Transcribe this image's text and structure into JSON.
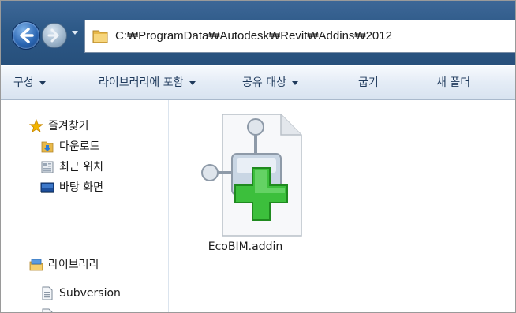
{
  "window": {
    "address_path": "C:₩ProgramData₩Autodesk₩Revit₩Addins₩2012"
  },
  "toolbar": {
    "items": [
      {
        "label": "구성",
        "has_dropdown": true
      },
      {
        "label": "라이브러리에 포함",
        "has_dropdown": true
      },
      {
        "label": "공유 대상",
        "has_dropdown": true
      },
      {
        "label": "굽기",
        "has_dropdown": false
      },
      {
        "label": "새 폴더",
        "has_dropdown": false
      }
    ]
  },
  "sidebar": {
    "favorites": {
      "label": "즐겨찾기",
      "icon": "star-icon",
      "items": [
        {
          "label": "다운로드",
          "icon": "downloads-folder-icon"
        },
        {
          "label": "최근 위치",
          "icon": "recent-places-icon"
        },
        {
          "label": "바탕 화면",
          "icon": "desktop-icon"
        }
      ]
    },
    "libraries": {
      "label": "라이브러리",
      "icon": "library-icon",
      "items": [
        {
          "label": "Subversion",
          "icon": "document-library-icon"
        }
      ]
    }
  },
  "files": [
    {
      "name": "EcoBIM.addin",
      "icon": "addin-file-icon"
    }
  ],
  "colors": {
    "titlebar": "#2d5987",
    "command_text": "#1e395b",
    "star": "#f2b400",
    "plus": "#3cbf3c"
  }
}
